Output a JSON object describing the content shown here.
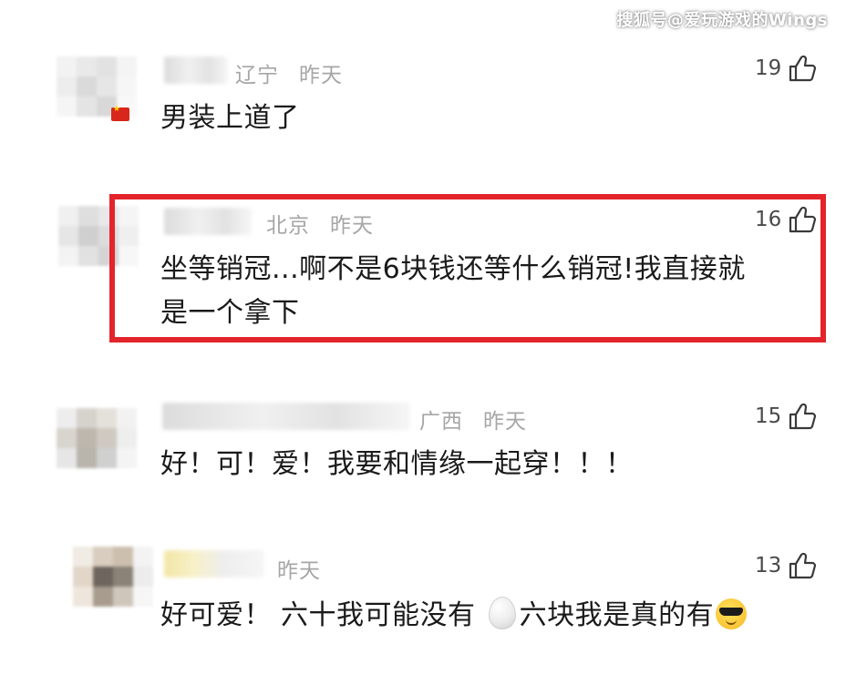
{
  "watermark": "搜狐号@爱玩游戏的Wings",
  "comments": [
    {
      "location": "辽宁",
      "time": "昨天",
      "likes": "19",
      "text": "男装上道了",
      "highlighted": false
    },
    {
      "location": "北京",
      "time": "昨天",
      "likes": "16",
      "text_line1": "坐等销冠...啊不是6块钱还等什么销冠!我直接就",
      "text_line2": "是一个拿下",
      "highlighted": true
    },
    {
      "location": "广西",
      "time": "昨天",
      "likes": "15",
      "text": "好！可！爱！我要和情缘一起穿！！！",
      "highlighted": false
    },
    {
      "time": "昨天",
      "likes": "13",
      "text_part1": "好可爱！ 六十我可能没有",
      "text_part2": "六块我是真的有",
      "highlighted": false
    }
  ],
  "icons": {
    "like": "thumbs-up-icon",
    "flag": "china-flag-icon",
    "egg": "egg-emoji-icon",
    "sunglasses": "sunglasses-emoji-icon"
  },
  "colors": {
    "highlight_border": "#e3242b",
    "meta_text": "#a6a6a6",
    "body_text": "#1a1a1a"
  }
}
